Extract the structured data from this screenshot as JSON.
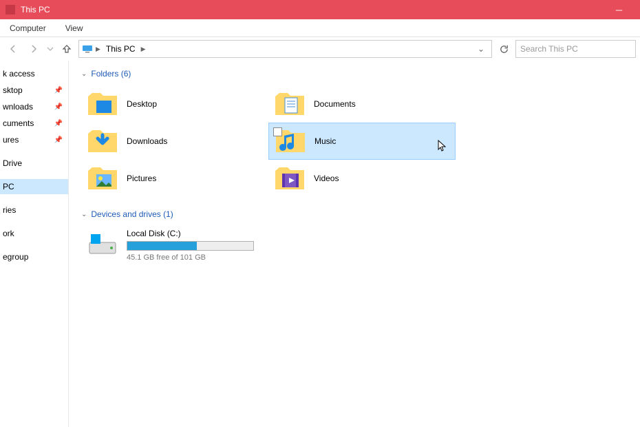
{
  "titlebar": {
    "title": "This PC"
  },
  "menubar": {
    "items": [
      "Computer",
      "View"
    ]
  },
  "path": {
    "segment": "This PC"
  },
  "search": {
    "placeholder": "Search This PC"
  },
  "sidebar": {
    "items": [
      {
        "label": "k access",
        "pin": false
      },
      {
        "label": "sktop",
        "pin": true
      },
      {
        "label": "wnloads",
        "pin": true
      },
      {
        "label": "cuments",
        "pin": true
      },
      {
        "label": "ures",
        "pin": true
      }
    ],
    "items2": [
      {
        "label": "Drive"
      }
    ],
    "items3": [
      {
        "label": "PC",
        "selected": true
      }
    ],
    "items4": [
      {
        "label": "ries"
      }
    ],
    "items5": [
      {
        "label": "ork"
      }
    ],
    "items6": [
      {
        "label": "egroup"
      }
    ]
  },
  "sections": {
    "folders": {
      "title": "Folders (6)",
      "items": [
        {
          "label": "Desktop",
          "icon": "desktop"
        },
        {
          "label": "Documents",
          "icon": "documents"
        },
        {
          "label": "Downloads",
          "icon": "downloads"
        },
        {
          "label": "Music",
          "icon": "music",
          "selected": true
        },
        {
          "label": "Pictures",
          "icon": "pictures"
        },
        {
          "label": "Videos",
          "icon": "videos"
        }
      ]
    },
    "drives": {
      "title": "Devices and drives (1)",
      "items": [
        {
          "label": "Local Disk (C:)",
          "free_text": "45.1 GB free of 101 GB",
          "used_pct": 55
        }
      ]
    }
  }
}
